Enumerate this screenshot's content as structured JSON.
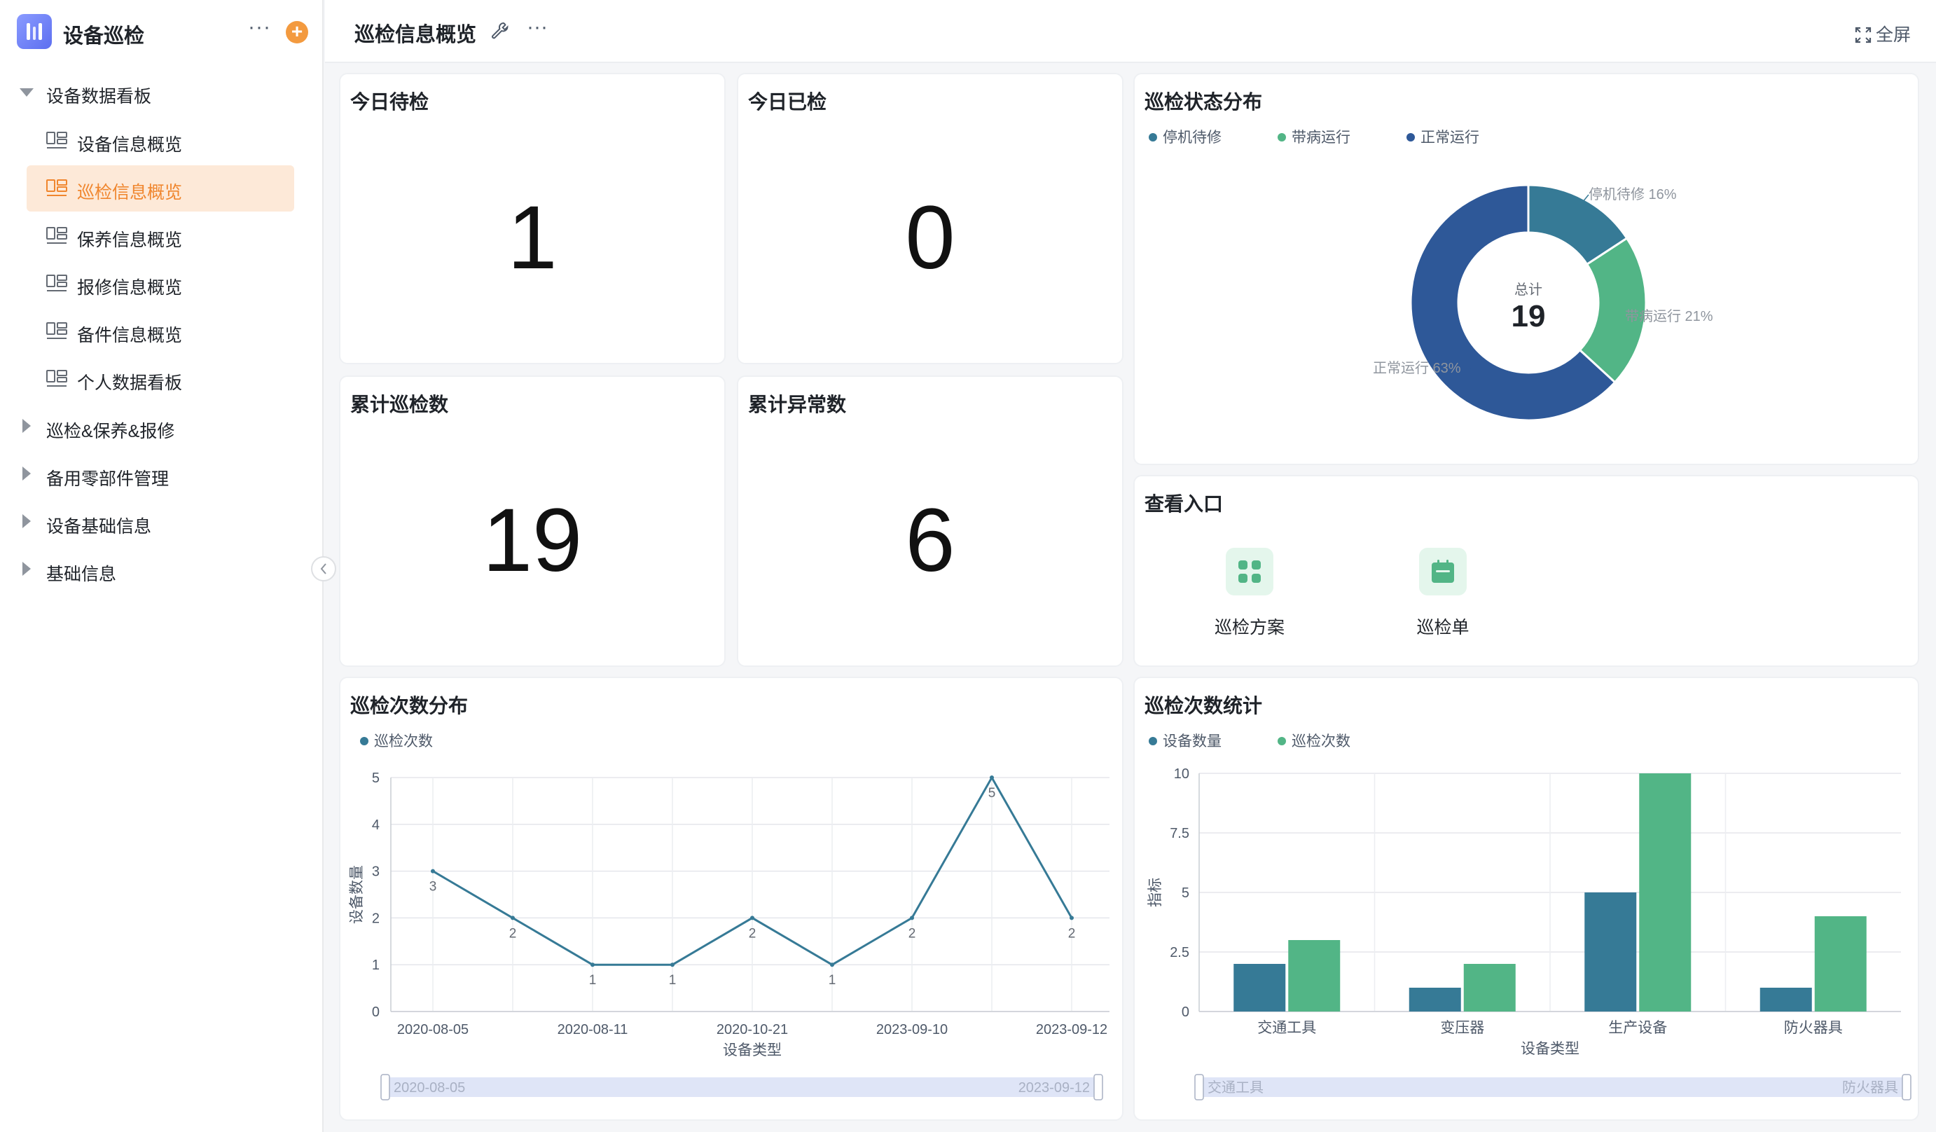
{
  "app": {
    "title": "设备巡检",
    "more_label": "···",
    "add_label": "+"
  },
  "sidebar": {
    "group_dashboard": "设备数据看板",
    "items": [
      {
        "label": "设备信息概览",
        "active": false
      },
      {
        "label": "巡检信息概览",
        "active": true
      },
      {
        "label": "保养信息概览",
        "active": false
      },
      {
        "label": "报修信息概览",
        "active": false
      },
      {
        "label": "备件信息概览",
        "active": false
      },
      {
        "label": "个人数据看板",
        "active": false
      }
    ],
    "groups": [
      "巡检&保养&报修",
      "备用零部件管理",
      "设备基础信息",
      "基础信息"
    ],
    "collapse_icon": "chevron-left-icon"
  },
  "header": {
    "title": "巡检信息概览",
    "more_label": "···",
    "fullscreen_label": "全屏"
  },
  "stats": {
    "today_pending": {
      "title": "今日待检",
      "value": "1"
    },
    "today_done": {
      "title": "今日已检",
      "value": "0"
    },
    "total_inspections": {
      "title": "累计巡检数",
      "value": "19"
    },
    "total_abnormal": {
      "title": "累计异常数",
      "value": "6"
    }
  },
  "entry_card": {
    "title": "查看入口",
    "entries": [
      {
        "label": "巡检方案",
        "icon": "grid-icon"
      },
      {
        "label": "巡检单",
        "icon": "calendar-icon"
      }
    ]
  },
  "colors": {
    "accent": "#f0862e",
    "teal": "#367a96",
    "green": "#52b586",
    "navy": "#2e5898"
  },
  "chart_data": [
    {
      "id": "status",
      "type": "pie",
      "title": "巡检状态分布",
      "center_label": "总计",
      "center_value": "19",
      "legend": [
        "停机待修",
        "带病运行",
        "正常运行"
      ],
      "slices": [
        {
          "name": "停机待修",
          "value": 3,
          "label": "停机待修 16%",
          "color": "#367a96"
        },
        {
          "name": "带病运行",
          "value": 4,
          "label": "带病运行 21%",
          "color": "#52b586"
        },
        {
          "name": "正常运行",
          "value": 12,
          "label": "正常运行 63%",
          "color": "#2e5898"
        }
      ]
    },
    {
      "id": "dist",
      "type": "line",
      "title": "巡检次数分布",
      "series": [
        {
          "name": "巡检次数",
          "color": "#367a96",
          "values": [
            3,
            2,
            1,
            1,
            2,
            1,
            2,
            5,
            2
          ]
        }
      ],
      "x": [
        "2020-08-05",
        "",
        "2020-08-11",
        "",
        "2020-10-21",
        "",
        "2023-09-10",
        "",
        "2023-09-12"
      ],
      "x_tick_labels": [
        "2020-08-05",
        "2020-08-11",
        "2020-10-21",
        "2023-09-10",
        "2023-09-12"
      ],
      "y_ticks": [
        "0",
        "1",
        "2",
        "3",
        "4",
        "5"
      ],
      "ylim": [
        0,
        5
      ],
      "xlabel": "设备类型",
      "ylabel": "设备数量",
      "grid": true,
      "slider": {
        "start": "2020-08-05",
        "end": "2023-09-12"
      }
    },
    {
      "id": "stats",
      "type": "bar",
      "title": "巡检次数统计",
      "categories": [
        "交通工具",
        "变压器",
        "生产设备",
        "防火器具"
      ],
      "series": [
        {
          "name": "设备数量",
          "color": "#367a96",
          "values": [
            2,
            1,
            5,
            1
          ]
        },
        {
          "name": "巡检次数",
          "color": "#52b586",
          "values": [
            3,
            2,
            10,
            4
          ]
        }
      ],
      "y_ticks": [
        "0",
        "2.5",
        "5",
        "7.5",
        "10"
      ],
      "ylim": [
        0,
        10
      ],
      "xlabel": "设备类型",
      "ylabel": "指标",
      "grid": true,
      "slider": {
        "start": "交通工具",
        "end": "防火器具"
      }
    }
  ]
}
